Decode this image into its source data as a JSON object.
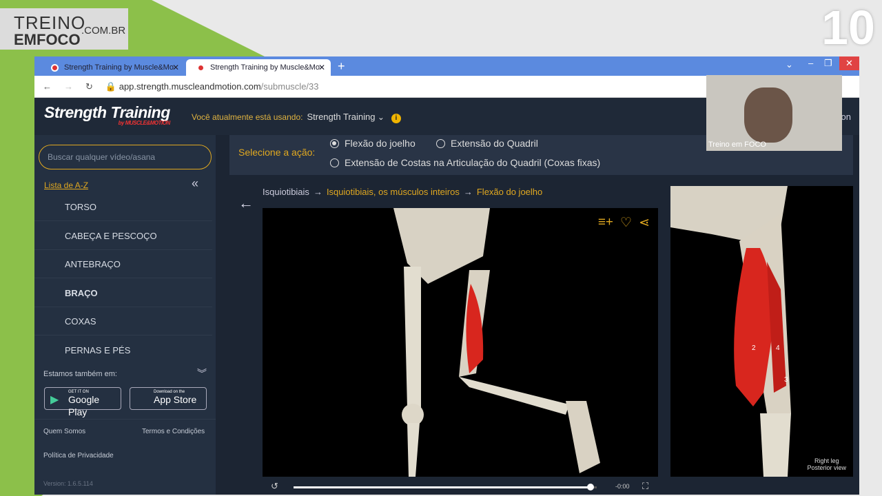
{
  "overlay": {
    "logo_line1": "TREINO",
    "logo_line2": "EMFOCO",
    "logo_domain": ".COM.BR",
    "badge": "10",
    "webcam_name": "Treino em FOCO"
  },
  "browser": {
    "tabs": [
      {
        "title": "Strength Training by Muscle&Mo"
      },
      {
        "title": "Strength Training by Muscle&Mo",
        "active": true
      }
    ],
    "url_host": "app.strength.muscleandmotion.com",
    "url_path": "/submuscle/33"
  },
  "header": {
    "brand": "Strength Training",
    "brand_sub": "by MUSCLE&MOTION",
    "using_label": "Você atualmente está usando:",
    "using_value": "Strength Training",
    "right_partial": "on"
  },
  "sidebar": {
    "search_placeholder": "Buscar qualquer vídeo/asana",
    "az_link": "Lista de A-Z",
    "categories": [
      "TORSO",
      "CABEÇA E PESCOÇO",
      "ANTEBRAÇO",
      "BRAÇO",
      "COXAS",
      "PERNAS E PÉS"
    ],
    "also_on": "Estamos também em:",
    "google_small": "GET IT ON",
    "google_big": "Google Play",
    "apple_small": "Download on the",
    "apple_big": "App Store",
    "links": [
      "Quem Somos",
      "Termos e Condições",
      "Política de Privacidade"
    ],
    "version": "Version: 1.6.5.114"
  },
  "action": {
    "label": "Selecione a ação:",
    "options": [
      {
        "label": "Flexão do joelho",
        "selected": true
      },
      {
        "label": "Extensão do Quadril",
        "selected": false
      },
      {
        "label": "Extensão de Costas na Articulação do Quadril (Coxas fixas)",
        "selected": false
      }
    ]
  },
  "breadcrumb": [
    "Isquiotibiais",
    "Isquiotibiais, os músculos inteiros",
    "Flexão do joelho"
  ],
  "video": {
    "time": "-0:00",
    "progress_percent": 98
  },
  "side_image": {
    "labels": [
      "2",
      "4",
      "3"
    ],
    "caption_line1": "Right leg",
    "caption_line2": "Posterior view"
  },
  "colors": {
    "accent": "#e0a820",
    "tabbar": "#5b8adf",
    "sidebar": "#243041",
    "muscle": "#d8261e"
  }
}
